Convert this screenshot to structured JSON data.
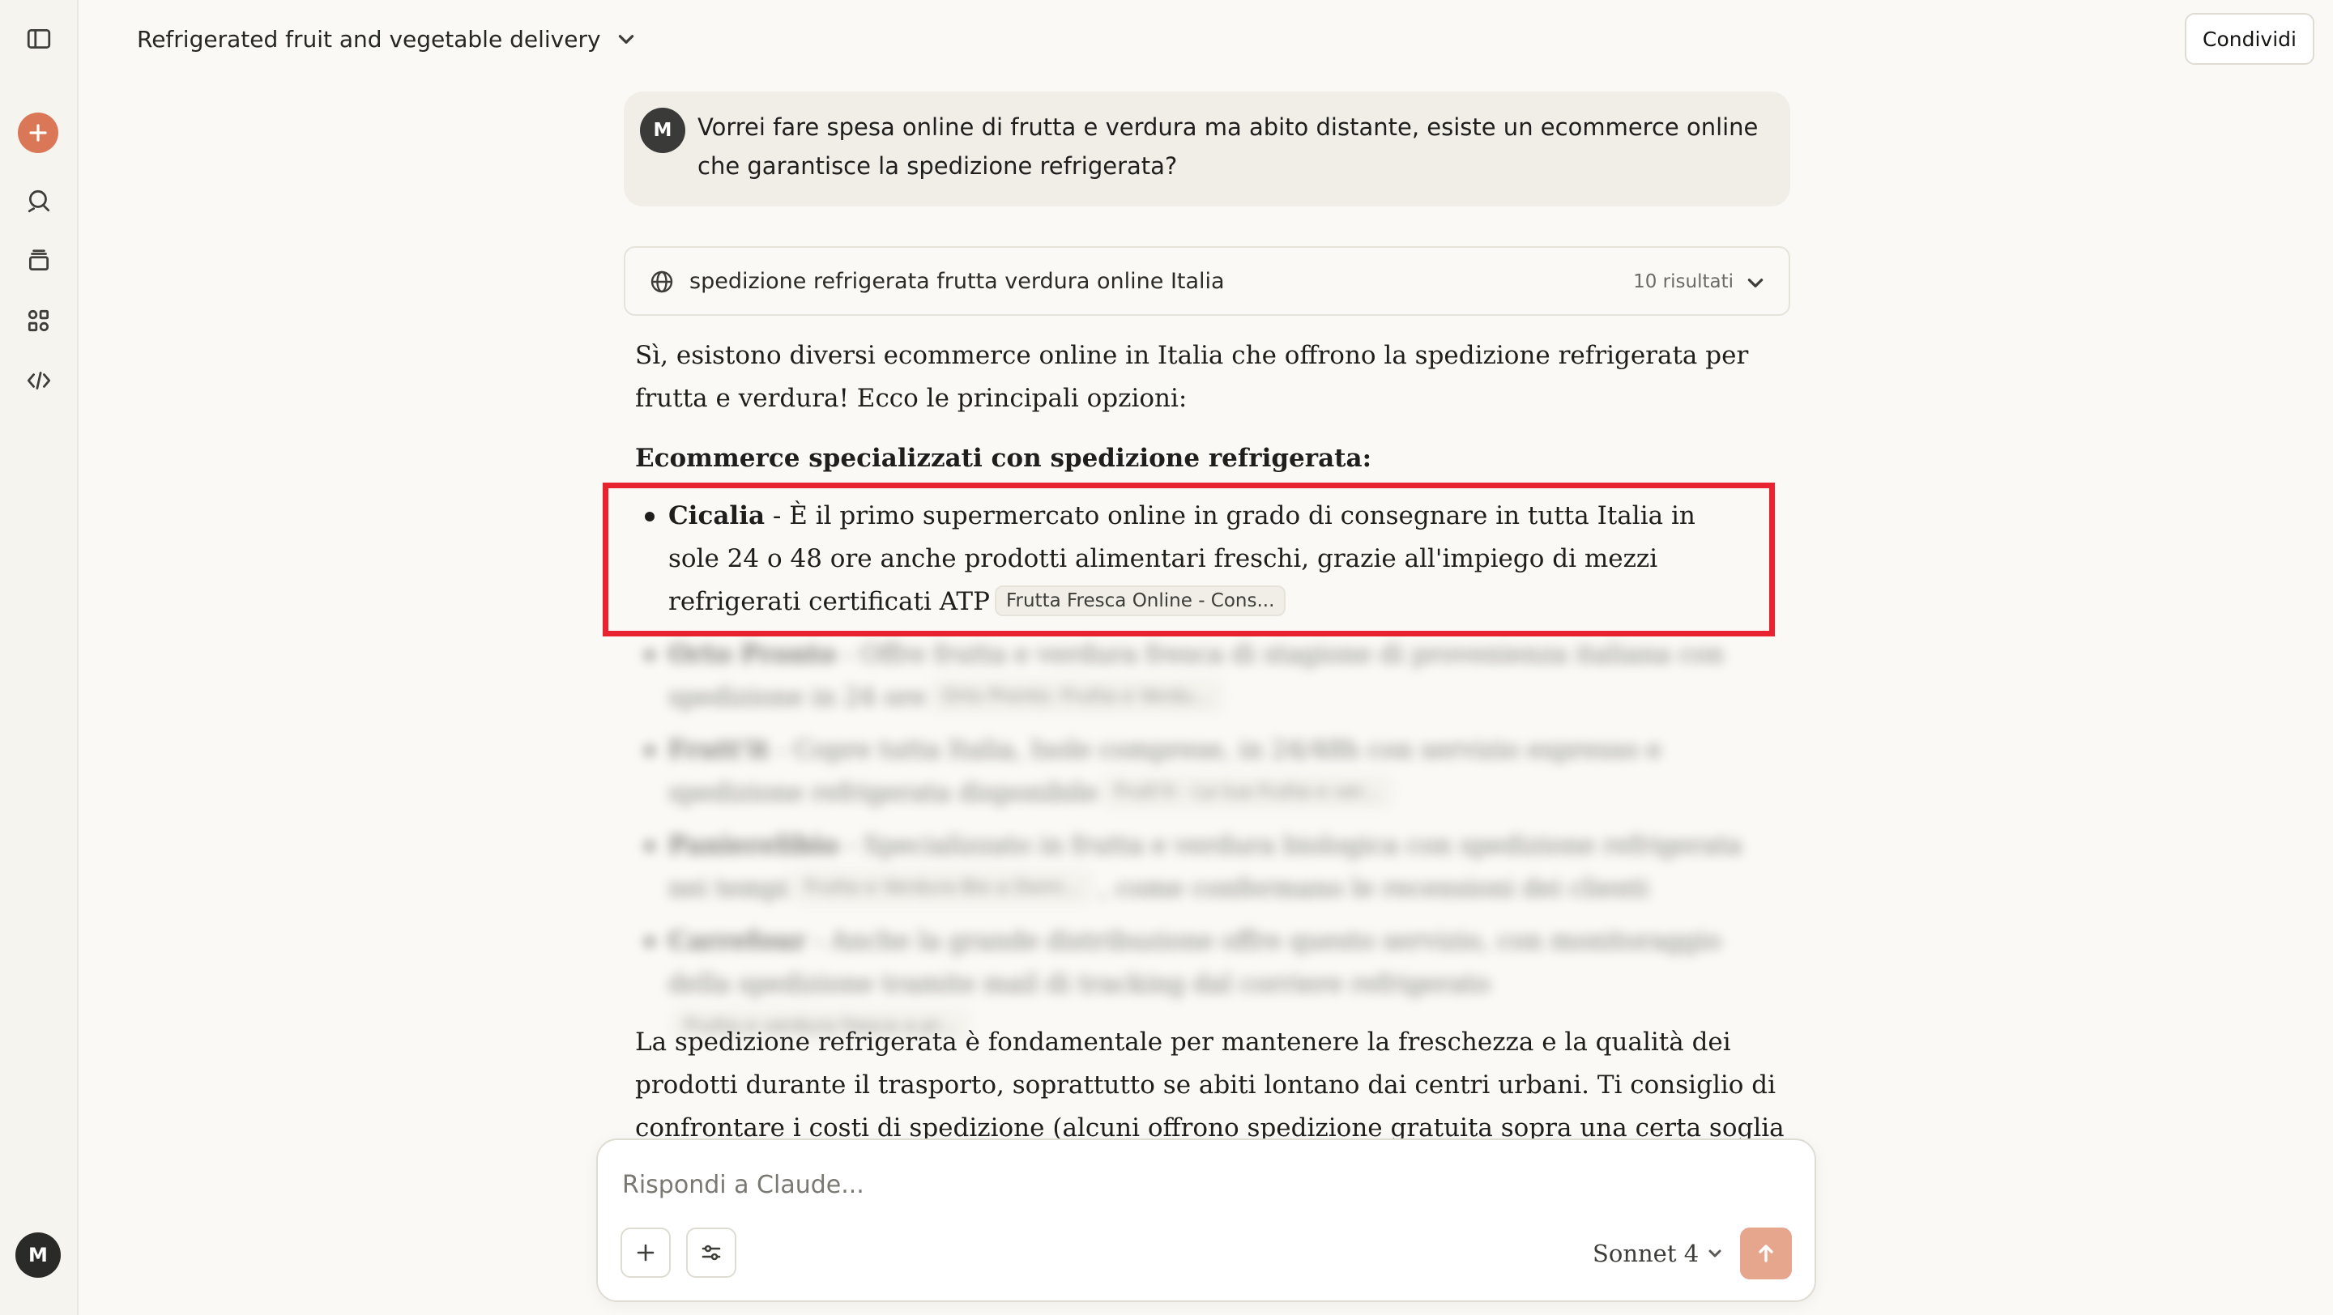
{
  "header": {
    "title": "Refrigerated fruit and vegetable delivery",
    "share_label": "Condividi"
  },
  "sidebar": {
    "items": [
      {
        "icon": "sidebar-toggle-icon"
      },
      {
        "icon": "new-chat-plus-icon"
      },
      {
        "icon": "chats-icon"
      },
      {
        "icon": "projects-icon"
      },
      {
        "icon": "artifacts-icon"
      },
      {
        "icon": "code-icon"
      }
    ],
    "user_initial": "M"
  },
  "user_message": {
    "avatar_initial": "M",
    "text": "Vorrei fare spesa online di frutta e verdura ma abito distante, esiste un ecommerce online che garantisce la spedizione refrigerata?"
  },
  "search": {
    "query": "spedizione refrigerata frutta verdura online Italia",
    "results_label": "10 risultati"
  },
  "response": {
    "intro": "Sì, esistono diversi ecommerce online in Italia che offrono la spedizione refrigerata per frutta e verdura! Ecco le principali opzioni:",
    "heading": "Ecommerce specializzati con spedizione refrigerata:",
    "bullets": [
      {
        "name": "Cicalia",
        "text": " - È il primo supermercato online in grado di consegnare in tutta Italia in sole 24 o 48 ore anche prodotti alimentari freschi, grazie all'impiego di mezzi refrigerati certificati ATP",
        "citation": "Frutta Fresca Online - Cons..."
      },
      {
        "name": "Orto Pronto",
        "text": " - Offre frutta e verdura fresca di stagione di provenienza italiana con spedizione in 24 ore",
        "citation": "Orto Pronto: Frutta e Verdu..."
      },
      {
        "name": "Frutt'it",
        "text": " - Copre tutta Italia, Isole comprese, in 24/48h con servizio espresso e spedizione refrigerata disponibile",
        "citation": "Frutt'it - La tua frutta e ver..."
      },
      {
        "name": "Panierelibio",
        "text": " - Specializzato in frutta e verdura biologica con spedizione refrigerata nei tempi",
        "citation": "Frutta e Verdura Bio a Domi...",
        "tail": " , come confermano le recensioni dei clienti"
      },
      {
        "name": "Carrefour",
        "text": " - Anche la grande distribuzione offre questo servizio, con monitoraggio della spedizione tramite mail di tracking dal corriere refrigerato",
        "citation": "Frutta e verdura fresca a pr..."
      }
    ],
    "outro": "La spedizione refrigerata è fondamentale per mantenere la freschezza e la qualità dei prodotti durante il trasporto, soprattutto se abiti lontano dai centri urbani. Ti consiglio di confrontare i costi di spedizione (alcuni offrono spedizione gratuita sopra una certa soglia"
  },
  "composer": {
    "placeholder": "Rispondi a Claude...",
    "model_label": "Sonnet 4"
  },
  "colors": {
    "accent": "#D97757",
    "highlight": "#E8232F",
    "send_button": "#E6A58D"
  }
}
